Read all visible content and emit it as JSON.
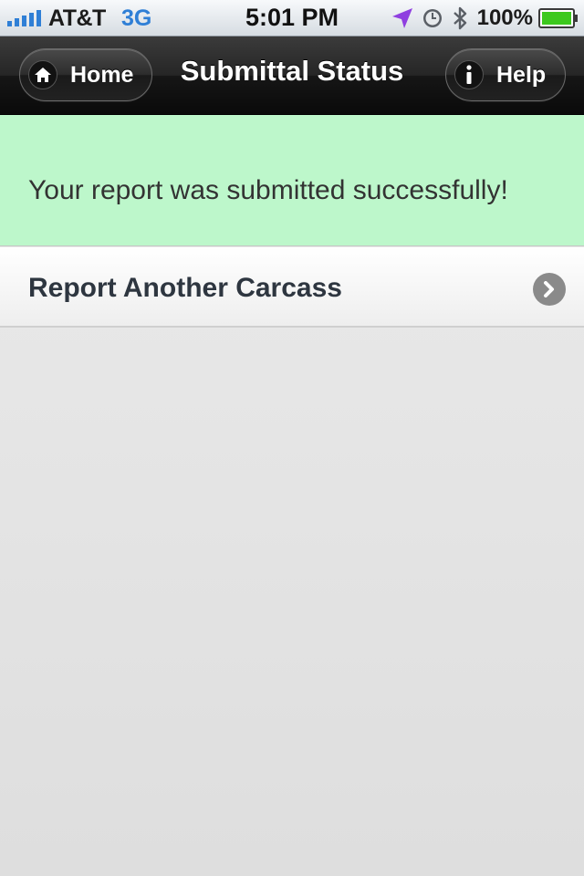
{
  "status_bar": {
    "carrier": "AT&T",
    "network": "3G",
    "time": "5:01 PM",
    "battery_percent": "100%",
    "icons": [
      "signal-icon",
      "location-arrow-icon",
      "clock-icon",
      "bluetooth-icon",
      "battery-icon"
    ],
    "colors": {
      "network": "#2f7fd6",
      "location": "#8f3fe0",
      "battery": "#3cc81e"
    }
  },
  "nav_bar": {
    "title": "Submittal Status",
    "home_label": "Home",
    "help_label": "Help",
    "icons": [
      "home-icon",
      "info-icon"
    ]
  },
  "message": {
    "text": "Your report was submitted successfully!",
    "background": "#bdf7cb"
  },
  "list": {
    "items": [
      {
        "label": "Report Another Carcass",
        "icon": "chevron-right-icon"
      }
    ]
  }
}
